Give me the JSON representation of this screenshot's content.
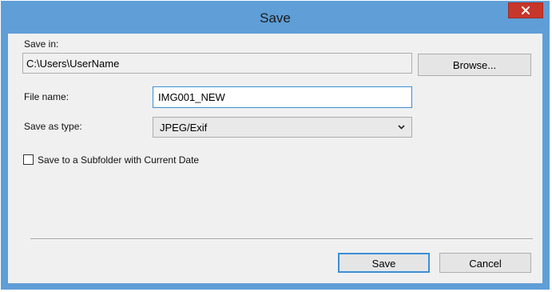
{
  "window": {
    "title": "Save",
    "close_icon": "close-icon",
    "colors": {
      "titlebar": "#5f9ed6",
      "close_button": "#c7362a",
      "client_background": "#f0f0f0",
      "focus_border": "#3c8fd6"
    }
  },
  "save_in": {
    "label": "Save in:",
    "path": "C:\\Users\\UserName",
    "browse_label": "Browse..."
  },
  "file_name": {
    "label": "File name:",
    "value": "IMG001_NEW"
  },
  "save_as_type": {
    "label": "Save as  type:",
    "selected": "JPEG/Exif",
    "icon": "chevron-down-icon"
  },
  "subfolder_option": {
    "label": "Save to a Subfolder with Current Date",
    "checked": false
  },
  "footer": {
    "save_label": "Save",
    "cancel_label": "Cancel"
  }
}
